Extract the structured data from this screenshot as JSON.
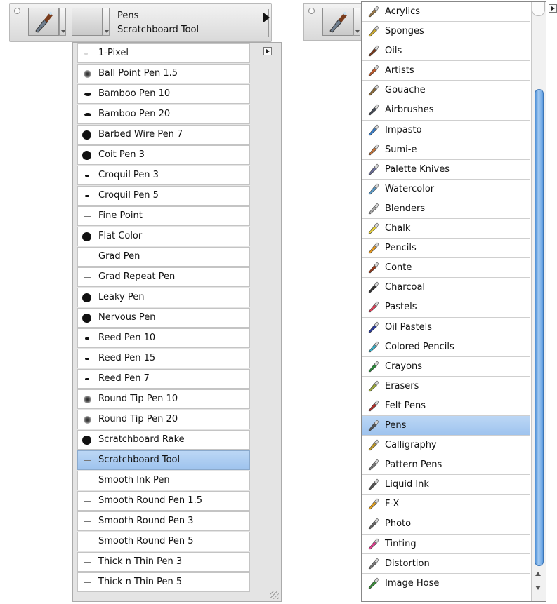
{
  "variant_toolbar": {
    "category_label": "Pens",
    "variant_label": "Scratchboard Tool"
  },
  "variants": [
    {
      "label": "1-Pixel",
      "dab": "pixel"
    },
    {
      "label": "Ball Point Pen 1.5",
      "dab": "soft"
    },
    {
      "label": "Bamboo Pen 10",
      "dab": "oval"
    },
    {
      "label": "Bamboo Pen 20",
      "dab": "oval"
    },
    {
      "label": "Barbed Wire Pen 7",
      "dab": "big"
    },
    {
      "label": "Coit Pen 3",
      "dab": "big"
    },
    {
      "label": "Croquil Pen 3",
      "dab": "dot"
    },
    {
      "label": "Croquil Pen 5",
      "dab": "dot"
    },
    {
      "label": "Fine Point",
      "dab": "line"
    },
    {
      "label": "Flat Color",
      "dab": "big"
    },
    {
      "label": "Grad Pen",
      "dab": "line"
    },
    {
      "label": "Grad Repeat Pen",
      "dab": "line"
    },
    {
      "label": "Leaky Pen",
      "dab": "big"
    },
    {
      "label": "Nervous Pen",
      "dab": "big"
    },
    {
      "label": "Reed Pen 10",
      "dab": "dot"
    },
    {
      "label": "Reed Pen 15",
      "dab": "dot"
    },
    {
      "label": "Reed Pen 7",
      "dab": "dot"
    },
    {
      "label": "Round Tip Pen 10",
      "dab": "soft"
    },
    {
      "label": "Round Tip Pen 20",
      "dab": "soft"
    },
    {
      "label": "Scratchboard Rake",
      "dab": "big"
    },
    {
      "label": "Scratchboard Tool",
      "dab": "line",
      "selected": true
    },
    {
      "label": "Smooth Ink Pen",
      "dab": "line"
    },
    {
      "label": "Smooth Round Pen 1.5",
      "dab": "line"
    },
    {
      "label": "Smooth Round Pen 3",
      "dab": "line"
    },
    {
      "label": "Smooth Round Pen 5",
      "dab": "line"
    },
    {
      "label": "Thick n Thin Pen 3",
      "dab": "line"
    },
    {
      "label": "Thick n Thin Pen 5",
      "dab": "line"
    }
  ],
  "categories": [
    {
      "label": "Acrylics",
      "icon": "acrylics-icon",
      "color": "#9b7a4a"
    },
    {
      "label": "Sponges",
      "icon": "sponges-icon",
      "color": "#c9a832"
    },
    {
      "label": "Oils",
      "icon": "oils-icon",
      "color": "#7a3a1c"
    },
    {
      "label": "Artists",
      "icon": "artists-icon",
      "color": "#c05a2a"
    },
    {
      "label": "Gouache",
      "icon": "gouache-icon",
      "color": "#8a6a3a"
    },
    {
      "label": "Airbrushes",
      "icon": "airbrushes-icon",
      "color": "#444a55"
    },
    {
      "label": "Impasto",
      "icon": "impasto-icon",
      "color": "#3a7ec8"
    },
    {
      "label": "Sumi-e",
      "icon": "sumi-e-icon",
      "color": "#c2743a"
    },
    {
      "label": "Palette Knives",
      "icon": "palette-knives-icon",
      "color": "#6b6f9a"
    },
    {
      "label": "Watercolor",
      "icon": "watercolor-icon",
      "color": "#5a9ac8"
    },
    {
      "label": "Blenders",
      "icon": "blenders-icon",
      "color": "#aaaaaa"
    },
    {
      "label": "Chalk",
      "icon": "chalk-icon",
      "color": "#e6cf3a"
    },
    {
      "label": "Pencils",
      "icon": "pencils-icon",
      "color": "#e79a1f"
    },
    {
      "label": "Conte",
      "icon": "conte-icon",
      "color": "#9a3a1a"
    },
    {
      "label": "Charcoal",
      "icon": "charcoal-icon",
      "color": "#333333"
    },
    {
      "label": "Pastels",
      "icon": "pastels-icon",
      "color": "#e0425a"
    },
    {
      "label": "Oil Pastels",
      "icon": "oil-pastels-icon",
      "color": "#2a3a9a"
    },
    {
      "label": "Colored Pencils",
      "icon": "colored-pencils-icon",
      "color": "#3ab0c8"
    },
    {
      "label": "Crayons",
      "icon": "crayons-icon",
      "color": "#2a8a3a"
    },
    {
      "label": "Erasers",
      "icon": "erasers-icon",
      "color": "#9aa83a"
    },
    {
      "label": "Felt Pens",
      "icon": "felt-pens-icon",
      "color": "#b0302a"
    },
    {
      "label": "Pens",
      "icon": "pens-icon",
      "color": "#555555",
      "selected": true
    },
    {
      "label": "Calligraphy",
      "icon": "calligraphy-icon",
      "color": "#c09a2a"
    },
    {
      "label": "Pattern Pens",
      "icon": "pattern-pens-icon",
      "color": "#777777"
    },
    {
      "label": "Liquid Ink",
      "icon": "liquid-ink-icon",
      "color": "#555555"
    },
    {
      "label": "F-X",
      "icon": "f-x-icon",
      "color": "#e0a020"
    },
    {
      "label": "Photo",
      "icon": "photo-icon",
      "color": "#666666"
    },
    {
      "label": "Tinting",
      "icon": "tinting-icon",
      "color": "#e04090"
    },
    {
      "label": "Distortion",
      "icon": "distortion-icon",
      "color": "#777777"
    },
    {
      "label": "Image Hose",
      "icon": "image-hose-icon",
      "color": "#3a8a3a"
    }
  ],
  "colors": {
    "selection_top": "#bcd7f5",
    "selection_bottom": "#9ec3ee",
    "scroll_thumb": "#4d8fd6"
  }
}
